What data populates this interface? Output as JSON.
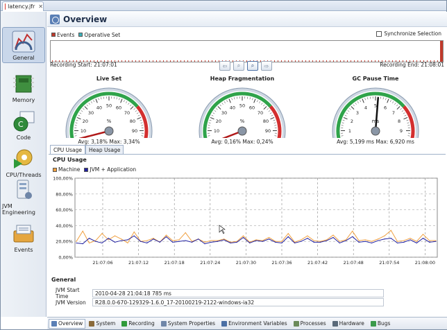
{
  "editor": {
    "tab_label": "latency.jfr"
  },
  "leftnav": {
    "items": [
      {
        "label": "General"
      },
      {
        "label": "Memory"
      },
      {
        "label": "Code"
      },
      {
        "label": "CPU/Threads"
      },
      {
        "label": "JVM Engineering"
      },
      {
        "label": "Events"
      }
    ]
  },
  "header": {
    "title": "Overview"
  },
  "range": {
    "legend_events": "Events",
    "legend_operative": "Operative Set",
    "sync_label": "Synchronize Selection",
    "start": "Recording Start: 21:07:01",
    "end": "Recording End: 21:08:01"
  },
  "gauges": [
    {
      "title": "Live Set",
      "unit": "%",
      "stats": "Avg: 3,18%   Max: 3,34%",
      "ticks": [
        "0",
        "10",
        "20",
        "30",
        "40",
        "50",
        "60",
        "70",
        "80",
        "90",
        "100"
      ]
    },
    {
      "title": "Heap Fragmentation",
      "unit": "%",
      "stats": "Avg: 0,16%   Max: 0,24%",
      "ticks": [
        "0",
        "10",
        "20",
        "30",
        "40",
        "50",
        "60",
        "70",
        "80",
        "90",
        "100"
      ]
    },
    {
      "title": "GC Pause Time",
      "unit": "ms",
      "stats": "Avg: 5,199 ms   Max: 6,920 ms",
      "ticks": [
        "0",
        "1",
        "2",
        "3",
        "4",
        "5",
        "6",
        "7",
        "8",
        "9",
        "10"
      ]
    }
  ],
  "subtabs": {
    "cpu": "CPU Usage",
    "heap": "Heap Usage"
  },
  "cpu": {
    "title": "CPU Usage",
    "legend_machine": "Machine",
    "legend_jvm": "JVM + Application"
  },
  "chart_data": {
    "type": "line",
    "title": "CPU Usage",
    "ylim": [
      0,
      100
    ],
    "yticks": [
      "0,00%",
      "20,00%",
      "40,00%",
      "60,00%",
      "80,00%",
      "100,00%"
    ],
    "xticks": [
      "21:07:06",
      "21:07:12",
      "21:07:18",
      "21:07:24",
      "21:07:30",
      "21:07:36",
      "21:07:42",
      "21:07:48",
      "21:07:54",
      "21:08:00"
    ],
    "series": [
      {
        "name": "Machine",
        "color": "#f0a040",
        "values": [
          20,
          33,
          18,
          21,
          30,
          22,
          27,
          23,
          18,
          32,
          20,
          21,
          24,
          19,
          28,
          21,
          22,
          31,
          20,
          23,
          19,
          21,
          21,
          23,
          19,
          20,
          27,
          19,
          22,
          21,
          25,
          20,
          20,
          30,
          19,
          22,
          27,
          21,
          20,
          22,
          28,
          20,
          22,
          33,
          21,
          22,
          20,
          23,
          27,
          34,
          20,
          21,
          24,
          20,
          29,
          21,
          21
        ]
      },
      {
        "name": "JVM + Application",
        "color": "#2020a0",
        "values": [
          18,
          17,
          24,
          20,
          18,
          24,
          19,
          21,
          22,
          27,
          20,
          18,
          23,
          19,
          26,
          19,
          20,
          21,
          19,
          23,
          17,
          19,
          20,
          22,
          18,
          19,
          25,
          18,
          21,
          20,
          23,
          19,
          18,
          26,
          18,
          20,
          24,
          19,
          19,
          21,
          25,
          18,
          21,
          26,
          19,
          20,
          18,
          21,
          23,
          24,
          18,
          19,
          22,
          18,
          24,
          19,
          20
        ]
      }
    ]
  },
  "general": {
    "title": "General",
    "start_label": "JVM Start Time",
    "start_value": "2010-04-28 21:04:18 785 ms",
    "version_label": "JVM Version",
    "version_value": "R28.0.0-670-129329-1.6.0_17-20100219-2122-windows-ia32"
  },
  "bottom_tabs": [
    "Overview",
    "System",
    "Recording",
    "System Properties",
    "Environment Variables",
    "Processes",
    "Hardware",
    "Bugs"
  ]
}
